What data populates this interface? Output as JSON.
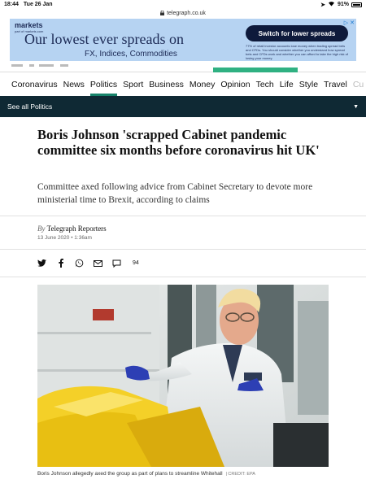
{
  "status": {
    "time": "18:44",
    "date": "Tue 26 Jan",
    "battery": "91%",
    "url": "telegraph.co.uk"
  },
  "ad": {
    "logo": "markets",
    "logo_sub": "part of markets.com",
    "headline": "Our lowest ever spreads on",
    "subline": "FX, Indices, Commodities",
    "button": "Switch for lower spreads",
    "disclaimer": "77% of retail investor accounts lose money when trading spread bets and CFDs. You should consider whether you understand how spread bets and CFDs work and whether you can afford to take the high risk of losing your money.",
    "close_glyphs": "▷ ✕"
  },
  "nav": {
    "items": [
      "Coronavirus",
      "News",
      "Politics",
      "Sport",
      "Business",
      "Money",
      "Opinion",
      "Tech",
      "Life",
      "Style",
      "Travel",
      "Cu"
    ],
    "active_index": 2,
    "section_link": "See all Politics"
  },
  "article": {
    "headline": "Boris Johnson 'scrapped Cabinet pandemic committee six months before coronavirus hit UK'",
    "standfirst": "Committee axed following advice from Cabinet Secretary to devote more ministerial time to Brexit, according to claims",
    "by": "By",
    "author": "Telegraph Reporters",
    "date": "13 June 2020 • 1:36am",
    "comment_count": "94",
    "caption": "Boris Johnson allegedly axed the group as part of plans to streamline Whitehall",
    "credit": "| CREDIT: EPA"
  },
  "icons": {
    "twitter": "twitter-icon",
    "facebook": "facebook-icon",
    "whatsapp": "whatsapp-icon",
    "email": "email-icon",
    "comment": "comment-icon"
  },
  "colors": {
    "section_bar": "#0f2934",
    "active_underline": "#17836a",
    "ad_background": "#b6d3f2",
    "ad_button": "#0e1a3b"
  }
}
